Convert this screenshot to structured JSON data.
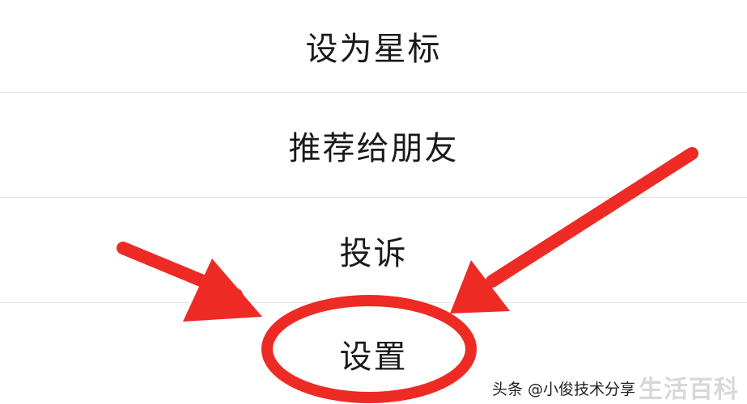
{
  "menu": {
    "items": [
      {
        "label": "设为星标"
      },
      {
        "label": "推荐给朋友"
      },
      {
        "label": "投诉"
      },
      {
        "label": "设置"
      }
    ]
  },
  "annotation": {
    "color": "#ee2a24",
    "shapes": [
      "circle-highlight",
      "arrow",
      "arrow"
    ]
  },
  "watermark": {
    "source": "头条 @小俊技术分享",
    "brand": "生活百科"
  }
}
